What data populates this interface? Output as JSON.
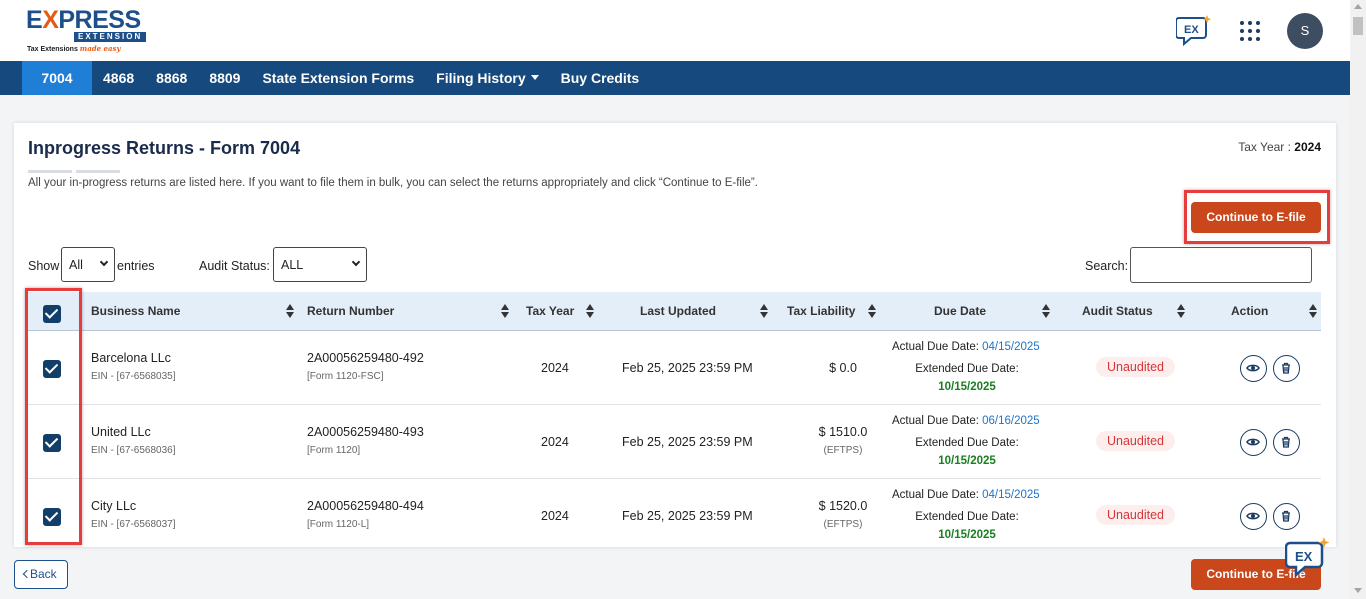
{
  "logo": {
    "express_prefix": "E",
    "express_x": "X",
    "express_rest": "PRESS",
    "extension": "EXTENSION",
    "tagline": "Tax Extensions",
    "tagline_script": "made easy"
  },
  "header": {
    "avatar_initial": "S"
  },
  "nav": {
    "items": [
      {
        "label": "7004"
      },
      {
        "label": "4868"
      },
      {
        "label": "8868"
      },
      {
        "label": "8809"
      },
      {
        "label": "State Extension Forms"
      },
      {
        "label": "Filing History"
      },
      {
        "label": "Buy Credits"
      }
    ]
  },
  "page": {
    "title": "Inprogress Returns - Form 7004",
    "tax_year_label": "Tax Year : ",
    "tax_year_value": "2024",
    "description": "All your in-progress returns are listed here. If you want to file them in bulk, you can select the returns appropriately and click “Continue to E-file”.",
    "continue_efile_label": "Continue to E-file"
  },
  "filters": {
    "show_label": "Show",
    "show_value": "All",
    "entries_label": "entries",
    "audit_status_label": "Audit Status:",
    "audit_status_value": "ALL",
    "search_label": "Search:",
    "search_value": ""
  },
  "table": {
    "columns": [
      "Business Name",
      "Return Number",
      "Tax Year",
      "Last Updated",
      "Tax Liability",
      "Due Date",
      "Audit Status",
      "Action"
    ],
    "rows": [
      {
        "business": "Barcelona LLc",
        "ein": "EIN - [67-6568035]",
        "return_number": "2A00056259480-492",
        "form": "[Form 1120-FSC]",
        "tax_year": "2024",
        "last_updated": "Feb 25, 2025 23:59 PM",
        "liability": "$ 0.0",
        "liability_sub": "",
        "actual_due_label": "Actual Due Date: ",
        "actual_due": "04/15/2025",
        "extended_label": "Extended Due Date:",
        "extended_due": "10/15/2025",
        "audit_status": "Unaudited",
        "checked": true
      },
      {
        "business": "United LLc",
        "ein": "EIN - [67-6568036]",
        "return_number": "2A00056259480-493",
        "form": "[Form 1120]",
        "tax_year": "2024",
        "last_updated": "Feb 25, 2025 23:59 PM",
        "liability": "$ 1510.0",
        "liability_sub": "(EFTPS)",
        "actual_due_label": "Actual Due Date: ",
        "actual_due": "06/16/2025",
        "extended_label": "Extended Due Date:",
        "extended_due": "10/15/2025",
        "audit_status": "Unaudited",
        "checked": true
      },
      {
        "business": "City LLc",
        "ein": "EIN - [67-6568037]",
        "return_number": "2A00056259480-494",
        "form": "[Form 1120-L]",
        "tax_year": "2024",
        "last_updated": "Feb 25, 2025 23:59 PM",
        "liability": "$ 1520.0",
        "liability_sub": "(EFTPS)",
        "actual_due_label": "Actual Due Date: ",
        "actual_due": "04/15/2025",
        "extended_label": "Extended Due Date:",
        "extended_due": "10/15/2025",
        "audit_status": "Unaudited",
        "checked": true
      }
    ]
  },
  "footer": {
    "back_label": "Back",
    "continue_efile_label": "Continue to E-file"
  },
  "colors": {
    "nav_bg": "#16497e",
    "nav_active": "#1f7ed6",
    "primary_button": "#c9471b",
    "highlight": "#e83b3b",
    "checkbox": "#123e6a",
    "date_blue": "#1f74c8",
    "date_green": "#1a7f1e",
    "badge_red": "#d4363a"
  },
  "icons": {
    "chat": "ex-chat-icon",
    "apps": "apps-grid-icon",
    "view": "eye-icon",
    "delete": "trash-icon",
    "back": "chevron-left-icon"
  }
}
